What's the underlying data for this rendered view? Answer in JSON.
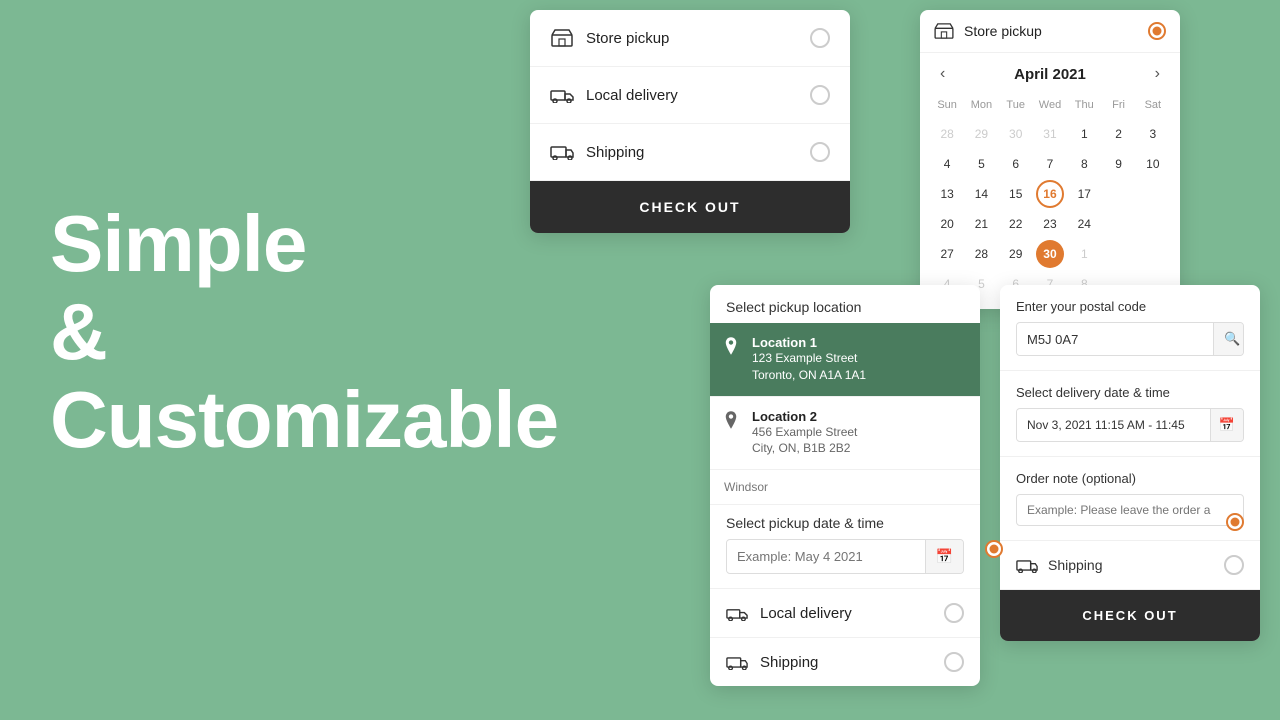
{
  "hero": {
    "line1": "Simple",
    "line2": "&",
    "line3": "Customizable"
  },
  "panel_method": {
    "options": [
      {
        "id": "store-pickup",
        "label": "Store pickup"
      },
      {
        "id": "local-delivery",
        "label": "Local delivery"
      },
      {
        "id": "shipping",
        "label": "Shipping"
      }
    ],
    "checkout_label": "CHECK OUT"
  },
  "panel_calendar": {
    "store_label": "Store pickup",
    "month": "April 2021",
    "weekdays": [
      "Sun",
      "Mon",
      "Tue",
      "Wed",
      "Thu",
      "Fri",
      "Sat"
    ],
    "weeks": [
      [
        "28",
        "29",
        "30",
        "31",
        "1",
        "2",
        "3"
      ],
      [
        "4",
        "5",
        "6",
        "7",
        "8",
        "9",
        "10"
      ],
      [
        "13",
        "14",
        "15",
        "16",
        "17",
        "",
        ""
      ],
      [
        "20",
        "21",
        "22",
        "23",
        "24",
        "",
        ""
      ],
      [
        "27",
        "28",
        "29",
        "30",
        "1",
        "",
        ""
      ],
      [
        "4",
        "5",
        "6",
        "7",
        "8",
        "",
        ""
      ]
    ],
    "today": "16",
    "selected": "30"
  },
  "panel_location": {
    "section_title": "Select pickup location",
    "locations": [
      {
        "name": "Location 1",
        "address": "123 Example Street",
        "city": "Toronto, ON A1A 1A1",
        "selected": true
      },
      {
        "name": "Location 2",
        "address": "456 Example Street",
        "city": "City, ON, B1B 2B2",
        "selected": false
      },
      {
        "name": "Windsor",
        "address": "",
        "city": "",
        "selected": false
      }
    ],
    "date_title": "Select pickup date & time",
    "date_placeholder": "Example: May 4 2021",
    "delivery_label": "Local delivery",
    "shipping_label": "Shipping"
  },
  "panel_detail": {
    "postal_label": "Enter your postal code",
    "postal_value": "M5J 0A7",
    "date_label": "Select delivery date & time",
    "date_value": "Nov 3, 2021 11:15 AM - 11:45",
    "note_label": "Order note (optional)",
    "note_placeholder": "Example: Please leave the order a",
    "shipping_label": "Shipping",
    "checkout_label": "CHECK OUT"
  }
}
